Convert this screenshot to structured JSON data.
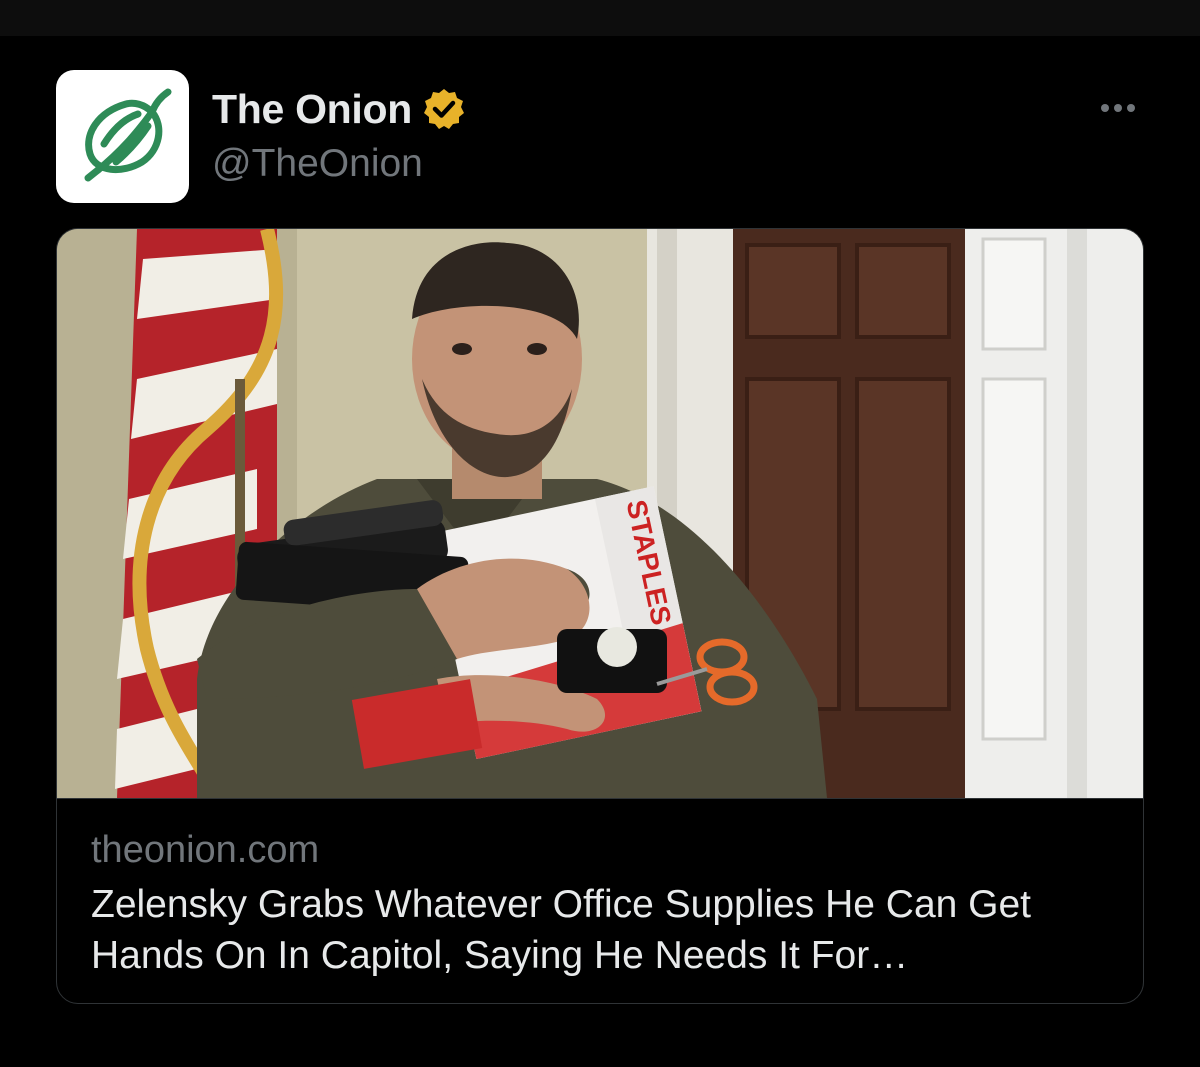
{
  "tweet": {
    "author": {
      "display_name": "The Onion",
      "handle": "@TheOnion",
      "verified": true,
      "avatar_icon": "onion-logo-icon",
      "avatar_color": "#2e8b57"
    },
    "more_icon": "more-options-icon",
    "link_card": {
      "image_icon": "article-photo",
      "domain": "theonion.com",
      "title": "Zelensky Grabs Whatever Office Supplies He Can Get Hands On In Capitol, Saying He Needs It For…",
      "image_text": "STAPLES"
    }
  },
  "colors": {
    "background": "#000000",
    "text_primary": "#e7e9ea",
    "text_secondary": "#71767b",
    "border": "#2f3336",
    "verified_badge": "#e8b22a"
  }
}
